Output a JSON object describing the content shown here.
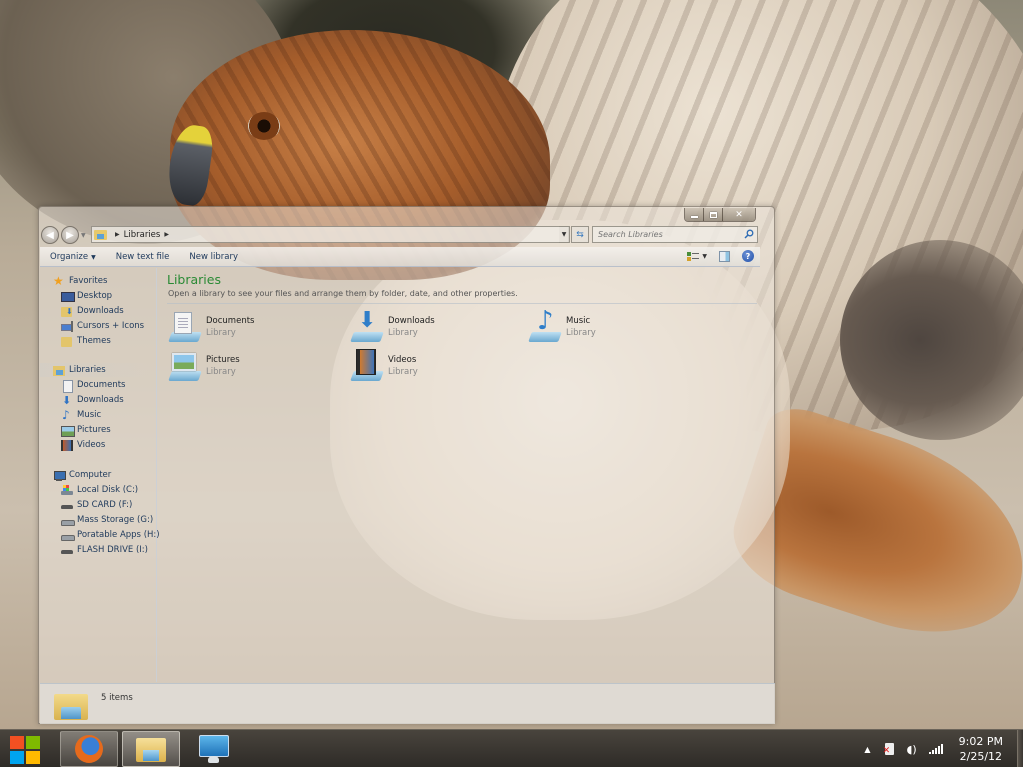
{
  "window": {
    "caption_buttons": {
      "minimize": "minimize",
      "maximize": "restore",
      "close": "✕"
    },
    "address_bar": {
      "breadcrumbs": [
        "Libraries"
      ]
    },
    "search": {
      "placeholder": "Search Libraries"
    },
    "toolbar": {
      "organize_label": "Organize",
      "new_text_file_label": "New text file",
      "new_library_label": "New library"
    },
    "nav_pane": {
      "favorites": {
        "label": "Favorites",
        "items": [
          {
            "label": "Desktop",
            "icon": "desktop-icon"
          },
          {
            "label": "Downloads",
            "icon": "downloads-folder-icon"
          },
          {
            "label": "Cursors + Icons",
            "icon": "cursor-icon"
          },
          {
            "label": "Themes",
            "icon": "folder-icon"
          }
        ]
      },
      "libraries": {
        "label": "Libraries",
        "items": [
          {
            "label": "Documents",
            "icon": "documents-icon"
          },
          {
            "label": "Downloads",
            "icon": "downloads-icon"
          },
          {
            "label": "Music",
            "icon": "music-icon"
          },
          {
            "label": "Pictures",
            "icon": "pictures-icon"
          },
          {
            "label": "Videos",
            "icon": "videos-icon"
          }
        ]
      },
      "computer": {
        "label": "Computer",
        "items": [
          {
            "label": "Local Disk (C:)",
            "icon": "system-drive-icon"
          },
          {
            "label": "SD CARD (F:)",
            "icon": "drive-icon"
          },
          {
            "label": "Mass Storage (G:)",
            "icon": "drive-icon"
          },
          {
            "label": "Poratable Apps (H:)",
            "icon": "drive-icon"
          },
          {
            "label": "FLASH DRIVE (I:)",
            "icon": "drive-icon"
          }
        ]
      }
    },
    "content": {
      "title": "Libraries",
      "description": "Open a library to see your files and arrange them by folder, date, and other properties.",
      "libraries": [
        {
          "name": "Documents",
          "type": "Library",
          "icon": "documents-library-icon"
        },
        {
          "name": "Downloads",
          "type": "Library",
          "icon": "downloads-library-icon"
        },
        {
          "name": "Music",
          "type": "Library",
          "icon": "music-library-icon"
        },
        {
          "name": "Pictures",
          "type": "Library",
          "icon": "pictures-library-icon"
        },
        {
          "name": "Videos",
          "type": "Library",
          "icon": "videos-library-icon"
        }
      ]
    },
    "status_bar": {
      "item_count": "5 items"
    }
  },
  "taskbar": {
    "apps": [
      {
        "name": "Firefox",
        "state": "running"
      },
      {
        "name": "Windows Explorer",
        "state": "active"
      },
      {
        "name": "Control Panel",
        "state": "pinned"
      }
    ],
    "tray": {
      "show_hidden": "▲",
      "volume": "🔈",
      "time": "9:02 PM",
      "date": "2/25/12"
    }
  },
  "colors": {
    "accent_title_green": "#2a8a35",
    "nav_text": "#1e395b",
    "taskbar": "#2e2b27"
  }
}
